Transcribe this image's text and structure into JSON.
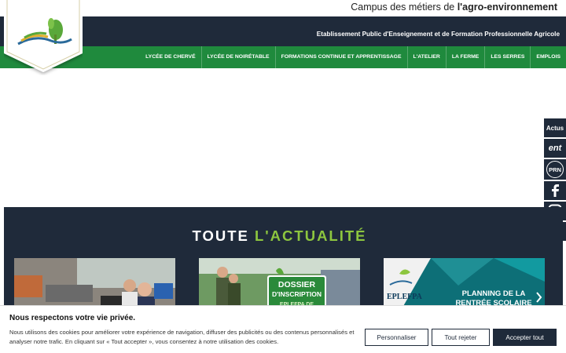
{
  "header": {
    "tagline_prefix": "Campus des métiers de ",
    "tagline_bold": "l'agro-environnement",
    "subtitle": "Etablissement Public d'Enseignement et de Formation Professionnelle Agricole"
  },
  "nav": {
    "items": [
      {
        "label": "LYCÉE DE CHERVÉ"
      },
      {
        "label": "LYCÉE DE NOIRÉTABLE"
      },
      {
        "label": "FORMATIONS CONTINUE ET APPRENTISSAGE"
      },
      {
        "label": "L'ATELIER"
      },
      {
        "label": "LA FERME"
      },
      {
        "label": "LES SERRES"
      },
      {
        "label": "EMPLOIS"
      }
    ]
  },
  "side": {
    "actus": "Actus",
    "ent": "ent",
    "prn": "PRN",
    "icons": [
      "facebook-icon",
      "instagram-icon",
      "youtube-icon"
    ]
  },
  "news": {
    "title_plain": "TOUTE ",
    "title_accent": "L'ACTUALITÉ",
    "cards": [
      {
        "caption": ""
      },
      {
        "caption_line1": "DOSSIER",
        "caption_line2": "D'INSCRIPTION",
        "caption_line3": "EPLEFPA DE"
      },
      {
        "logo": "EPLEFPA",
        "caption_line1": "PLANNING DE LA",
        "caption_line2": "RENTRÉE SCOLAIRE"
      }
    ]
  },
  "cookie": {
    "title": "Nous respectons votre vie privée.",
    "text": "Nous utilisons des cookies pour améliorer votre expérience de navigation, diffuser des publicités ou des contenus personnalisés et analyser notre trafic. En cliquant sur « Tout accepter », vous consentez à notre utilisation des cookies.",
    "btn_customize": "Personnaliser",
    "btn_reject": "Tout rejeter",
    "btn_accept": "Accepter tout"
  },
  "colors": {
    "dark": "#1f2a3a",
    "green": "#1f8a3d",
    "accent": "#8dc63f"
  }
}
